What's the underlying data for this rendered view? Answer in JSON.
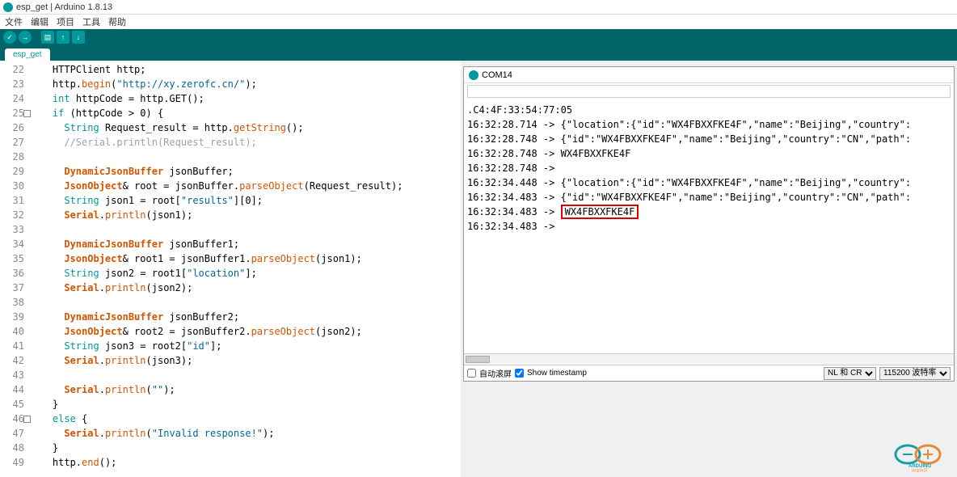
{
  "window": {
    "title": "esp_get | Arduino 1.8.13"
  },
  "menu": [
    "文件",
    "编辑",
    "项目",
    "工具",
    "帮助"
  ],
  "tab": "esp_get",
  "gutter_start": 22,
  "code_lines": [
    {
      "indent": "    ",
      "tokens": [
        [
          "",
          "HTTPClient http;"
        ]
      ]
    },
    {
      "indent": "    ",
      "tokens": [
        [
          "",
          "http."
        ],
        [
          "fn",
          "begin"
        ],
        [
          "",
          "("
        ],
        [
          "str",
          "\"http://xy.zerofc.cn/\""
        ],
        [
          "",
          ");"
        ]
      ]
    },
    {
      "indent": "    ",
      "tokens": [
        [
          "kw",
          "int"
        ],
        [
          "",
          " httpCode = http.GET();"
        ]
      ]
    },
    {
      "indent": "    ",
      "tokens": [
        [
          "kw",
          "if"
        ],
        [
          "",
          " (httpCode > 0) {"
        ]
      ],
      "fold": true
    },
    {
      "indent": "      ",
      "tokens": [
        [
          "kw",
          "String"
        ],
        [
          "",
          " Request_result = http."
        ],
        [
          "fn",
          "getString"
        ],
        [
          "",
          "();"
        ]
      ]
    },
    {
      "indent": "      ",
      "tokens": [
        [
          "comment",
          "//Serial.println(Request_result);"
        ]
      ]
    },
    {
      "indent": "",
      "tokens": []
    },
    {
      "indent": "      ",
      "tokens": [
        [
          "type",
          "DynamicJsonBuffer"
        ],
        [
          "",
          " jsonBuffer;"
        ]
      ]
    },
    {
      "indent": "      ",
      "tokens": [
        [
          "type",
          "JsonObject"
        ],
        [
          "",
          "& root = jsonBuffer."
        ],
        [
          "fn",
          "parseObject"
        ],
        [
          "",
          "(Request_result);"
        ]
      ]
    },
    {
      "indent": "      ",
      "tokens": [
        [
          "kw",
          "String"
        ],
        [
          "",
          " json1 = root["
        ],
        [
          "str",
          "\"results\""
        ],
        [
          "",
          "][0];"
        ]
      ]
    },
    {
      "indent": "      ",
      "tokens": [
        [
          "type",
          "Serial"
        ],
        [
          "",
          "."
        ],
        [
          "fn",
          "println"
        ],
        [
          "",
          "(json1);"
        ]
      ]
    },
    {
      "indent": "",
      "tokens": []
    },
    {
      "indent": "      ",
      "tokens": [
        [
          "type",
          "DynamicJsonBuffer"
        ],
        [
          "",
          " jsonBuffer1;"
        ]
      ]
    },
    {
      "indent": "      ",
      "tokens": [
        [
          "type",
          "JsonObject"
        ],
        [
          "",
          "& root1 = jsonBuffer1."
        ],
        [
          "fn",
          "parseObject"
        ],
        [
          "",
          "(json1);"
        ]
      ]
    },
    {
      "indent": "      ",
      "tokens": [
        [
          "kw",
          "String"
        ],
        [
          "",
          " json2 = root1["
        ],
        [
          "str",
          "\"location\""
        ],
        [
          "",
          "];"
        ]
      ]
    },
    {
      "indent": "      ",
      "tokens": [
        [
          "type",
          "Serial"
        ],
        [
          "",
          "."
        ],
        [
          "fn",
          "println"
        ],
        [
          "",
          "(json2);"
        ]
      ]
    },
    {
      "indent": "",
      "tokens": []
    },
    {
      "indent": "      ",
      "tokens": [
        [
          "type",
          "DynamicJsonBuffer"
        ],
        [
          "",
          " jsonBuffer2;"
        ]
      ]
    },
    {
      "indent": "      ",
      "tokens": [
        [
          "type",
          "JsonObject"
        ],
        [
          "",
          "& root2 = jsonBuffer2."
        ],
        [
          "fn",
          "parseObject"
        ],
        [
          "",
          "(json2);"
        ]
      ]
    },
    {
      "indent": "      ",
      "tokens": [
        [
          "kw",
          "String"
        ],
        [
          "",
          " json3 = root2["
        ],
        [
          "str",
          "\"id\""
        ],
        [
          "",
          "];"
        ]
      ]
    },
    {
      "indent": "      ",
      "tokens": [
        [
          "type",
          "Serial"
        ],
        [
          "",
          "."
        ],
        [
          "fn",
          "println"
        ],
        [
          "",
          "(json3);"
        ]
      ]
    },
    {
      "indent": "",
      "tokens": []
    },
    {
      "indent": "      ",
      "tokens": [
        [
          "type",
          "Serial"
        ],
        [
          "",
          "."
        ],
        [
          "fn",
          "println"
        ],
        [
          "",
          "("
        ],
        [
          "str",
          "\"\""
        ],
        [
          "",
          ");"
        ]
      ]
    },
    {
      "indent": "    ",
      "tokens": [
        [
          "",
          "}"
        ]
      ]
    },
    {
      "indent": "    ",
      "tokens": [
        [
          "kw",
          "else"
        ],
        [
          "",
          " {"
        ]
      ],
      "fold": true
    },
    {
      "indent": "      ",
      "tokens": [
        [
          "type",
          "Serial"
        ],
        [
          "",
          "."
        ],
        [
          "fn",
          "println"
        ],
        [
          "",
          "("
        ],
        [
          "str",
          "\"Invalid response!\""
        ],
        [
          "",
          ");"
        ]
      ]
    },
    {
      "indent": "    ",
      "tokens": [
        [
          "",
          "}"
        ]
      ]
    },
    {
      "indent": "    ",
      "tokens": [
        [
          "",
          "http."
        ],
        [
          "fn",
          "end"
        ],
        [
          "",
          "();"
        ]
      ]
    }
  ],
  "serial": {
    "title": "COM14",
    "lines": [
      ".C4:4F:33:54:77:05",
      "16:32:28.714 -> {\"location\":{\"id\":\"WX4FBXXFKE4F\",\"name\":\"Beijing\",\"country\":",
      "16:32:28.748 -> {\"id\":\"WX4FBXXFKE4F\",\"name\":\"Beijing\",\"country\":\"CN\",\"path\":",
      "16:32:28.748 -> WX4FBXXFKE4F",
      "16:32:28.748 -> ",
      "16:32:34.448 -> {\"location\":{\"id\":\"WX4FBXXFKE4F\",\"name\":\"Beijing\",\"country\":",
      "16:32:34.483 -> {\"id\":\"WX4FBXXFKE4F\",\"name\":\"Beijing\",\"country\":\"CN\",\"path\":",
      "16:32:34.483 -> |WX4FBXXFKE4F|",
      "16:32:34.483 -> "
    ],
    "footer": {
      "autoscroll": "自动滚屏",
      "showts": "Show timestamp",
      "lineend": "NL 和 CR",
      "baud": "115200 波特率"
    }
  },
  "logo_text": "ARDUINO",
  "logo_sub": "中文社区"
}
